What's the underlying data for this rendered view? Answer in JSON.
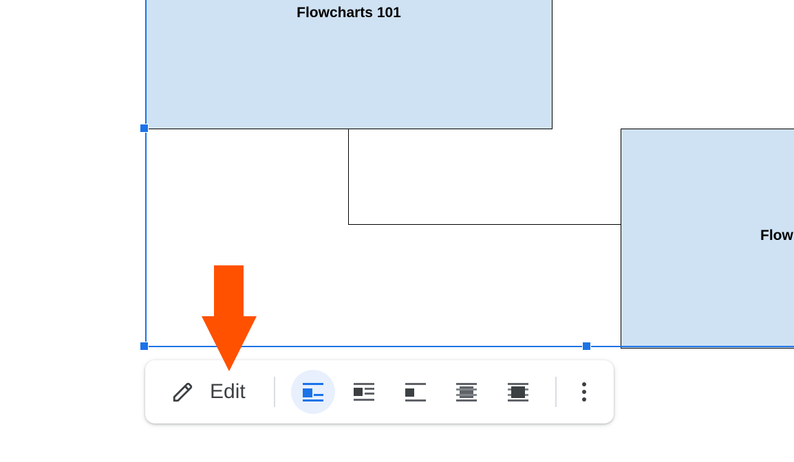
{
  "diagram": {
    "boxes": [
      {
        "label": "Flowcharts 101"
      },
      {
        "label": "Flow"
      }
    ],
    "fill_color": "#cfe2f3",
    "selection_color": "#1a73e8"
  },
  "toolbar": {
    "edit_label": "Edit",
    "edit_icon": "pencil-icon",
    "wrap_options": [
      {
        "icon": "inline-icon",
        "active": true
      },
      {
        "icon": "wrap-text-icon",
        "active": false
      },
      {
        "icon": "break-text-icon",
        "active": false
      },
      {
        "icon": "behind-text-icon",
        "active": false
      },
      {
        "icon": "in-front-of-text-icon",
        "active": false
      }
    ],
    "more_icon": "more-vert-icon",
    "active_color": "#1a73e8"
  },
  "annotation": {
    "arrow_icon": "down-arrow-icon",
    "arrow_color": "#ff5100"
  }
}
